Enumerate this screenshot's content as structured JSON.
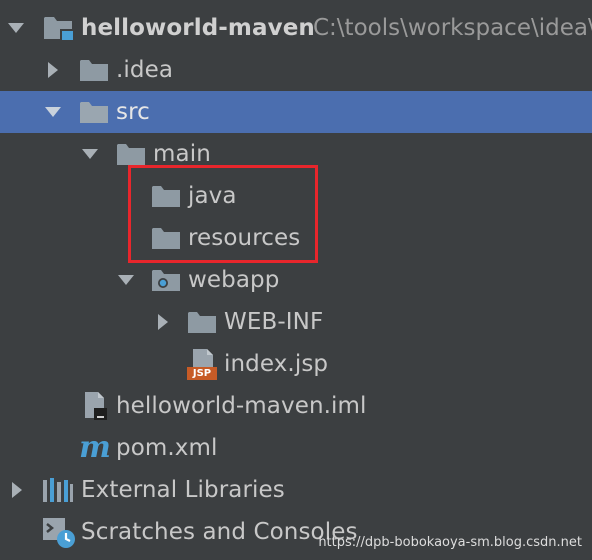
{
  "tree": {
    "root": {
      "label": "helloworld-maven",
      "path": "C:\\tools\\workspace\\idea\\"
    },
    "idea": {
      "label": ".idea"
    },
    "src": {
      "label": "src"
    },
    "main": {
      "label": "main"
    },
    "java": {
      "label": "java"
    },
    "resources": {
      "label": "resources"
    },
    "webapp": {
      "label": "webapp"
    },
    "webinf": {
      "label": "WEB-INF"
    },
    "indexjsp": {
      "label": "index.jsp",
      "badge": "JSP"
    },
    "iml": {
      "label": "helloworld-maven.iml"
    },
    "pom": {
      "label": "pom.xml",
      "icon_text": "m"
    },
    "external": {
      "label": "External Libraries"
    },
    "scratches": {
      "label": "Scratches and Consoles"
    }
  },
  "watermark": "https://dpb-bobokaoya-sm.blog.csdn.net",
  "colors": {
    "background": "#3c3f41",
    "selection": "#4b6eaf",
    "folder": "#8e9aa3",
    "highlight_box": "#e8262c",
    "maven_blue": "#4a9fd5",
    "jsp_badge": "#c75b26"
  },
  "icons": {
    "root": "module-folder-icon",
    "folder": "folder-icon",
    "webapp": "web-folder-icon",
    "jsp": "jsp-file-icon",
    "iml": "iml-file-icon",
    "pom": "maven-icon",
    "external": "library-icon",
    "scratches": "scratches-icon"
  }
}
